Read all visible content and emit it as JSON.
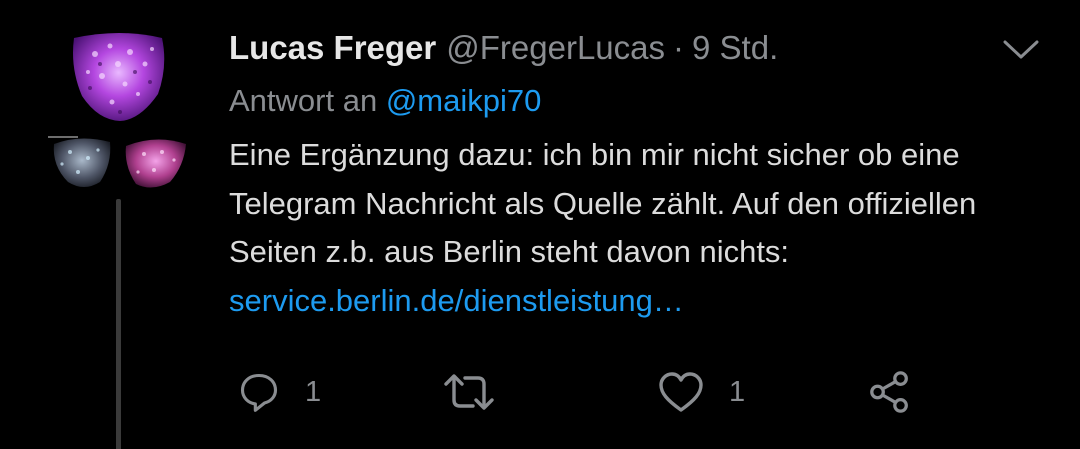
{
  "tweet": {
    "display_name": "Lucas Freger",
    "handle": "@FregerLucas",
    "separator": "·",
    "time": "9 Std.",
    "reply_prefix": "Antwort an",
    "reply_to": "@maikpi70",
    "text_main": "Eine Ergänzung dazu: ich bin mir nicht sicher ob eine Telegram Nachricht als Quelle zählt. Auf den offiziellen Seiten z.b. aus Berlin steht davon nichts: ",
    "link_text": "service.berlin.de/dienstleistung…"
  },
  "actions": {
    "reply_count": "1",
    "retweet_count": "",
    "like_count": "1"
  },
  "icons": {
    "menu": "chevron-down-icon",
    "reply": "reply-icon",
    "retweet": "retweet-icon",
    "like": "heart-icon",
    "share": "share-icon"
  },
  "colors": {
    "background": "#000000",
    "link": "#1d9bf0",
    "secondary_text": "#8a8d91",
    "primary_text": "#e7e7e7"
  }
}
